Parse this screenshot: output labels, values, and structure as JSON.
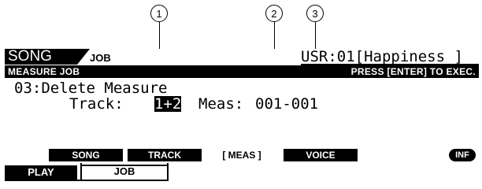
{
  "callouts": [
    "1",
    "2",
    "3"
  ],
  "screen": {
    "mode": "SONG",
    "sub_mode": "JOB",
    "song_slot": "USR:01[Happiness ]",
    "header_left": "MEASURE JOB",
    "header_right": "PRESS [ENTER] TO EXEC.",
    "job_title": "03:Delete Measure",
    "track_label": "Track:",
    "track_value": "1+2",
    "meas_label": "Meas:",
    "meas_value": "001-001"
  },
  "softkeys": [
    "SONG",
    "TRACK",
    "[ MEAS ]",
    "VOICE"
  ],
  "inf_button": "INF",
  "tabs": [
    "PLAY",
    "JOB"
  ]
}
